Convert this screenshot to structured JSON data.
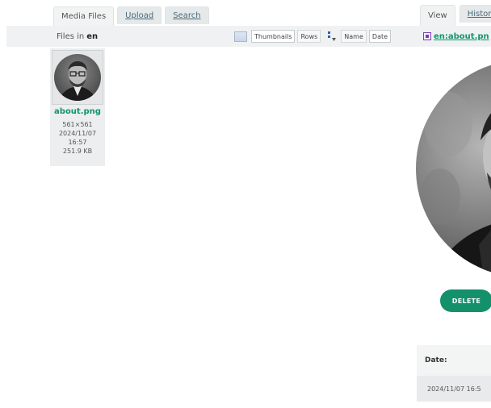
{
  "left_tabs": [
    {
      "label": "Media Files",
      "active": true
    },
    {
      "label": "Upload",
      "active": false
    },
    {
      "label": "Search",
      "active": false
    }
  ],
  "toolbar": {
    "files_in_prefix": "Files in",
    "namespace": "en",
    "view_thumbnails": "Thumbnails",
    "view_rows": "Rows",
    "sort_name": "Name",
    "sort_date": "Date"
  },
  "thumbnail": {
    "name": "about.png",
    "dimensions": "561×561",
    "date": "2024/11/07",
    "time": "16:57",
    "size": "251.9 KB"
  },
  "right_tabs": [
    {
      "label": "View",
      "active": true
    },
    {
      "label": "Histor",
      "active": false
    }
  ],
  "detail": {
    "file_link": "en:about.pn",
    "delete_label": "DELETE",
    "date_label": "Date:",
    "date_value": "2024/11/07 16:5"
  },
  "colors": {
    "accent": "#12956c",
    "toolbar_bg": "#eff1f2"
  },
  "icons": [
    "thumbnails-icon",
    "sort-direction-icon",
    "image-file-icon"
  ]
}
